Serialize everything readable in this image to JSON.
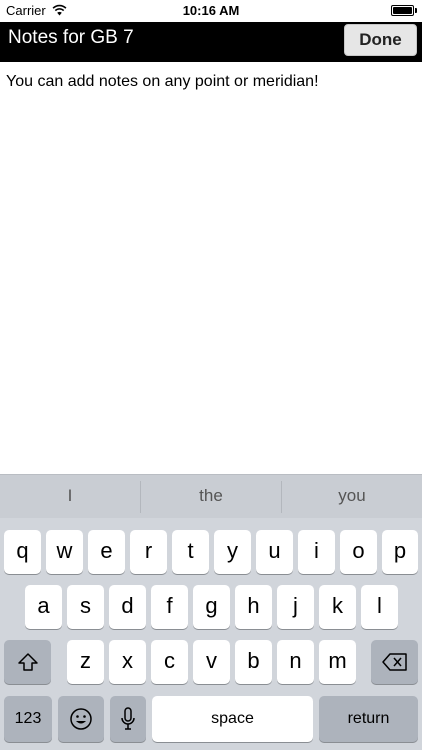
{
  "status_bar": {
    "carrier": "Carrier",
    "time": "10:16 AM",
    "battery_level": 1.0
  },
  "header": {
    "title": "Notes for GB 7",
    "done_label": "Done"
  },
  "notes": {
    "text": "You can add notes on any point or meridian!"
  },
  "keyboard": {
    "suggestions": [
      "I",
      "the",
      "you"
    ],
    "row1": [
      "q",
      "w",
      "e",
      "r",
      "t",
      "y",
      "u",
      "i",
      "o",
      "p"
    ],
    "row2": [
      "a",
      "s",
      "d",
      "f",
      "g",
      "h",
      "j",
      "k",
      "l"
    ],
    "row3": [
      "z",
      "x",
      "c",
      "v",
      "b",
      "n",
      "m"
    ],
    "numbers_label": "123",
    "space_label": "space",
    "return_label": "return",
    "icons": {
      "shift": "shift-icon",
      "delete": "backspace-icon",
      "emoji": "emoji-icon",
      "dictation": "microphone-icon"
    }
  },
  "colors": {
    "header_bg": "#000000",
    "keyboard_bg": "#d1d5db",
    "function_key_bg": "#adb3bc"
  }
}
